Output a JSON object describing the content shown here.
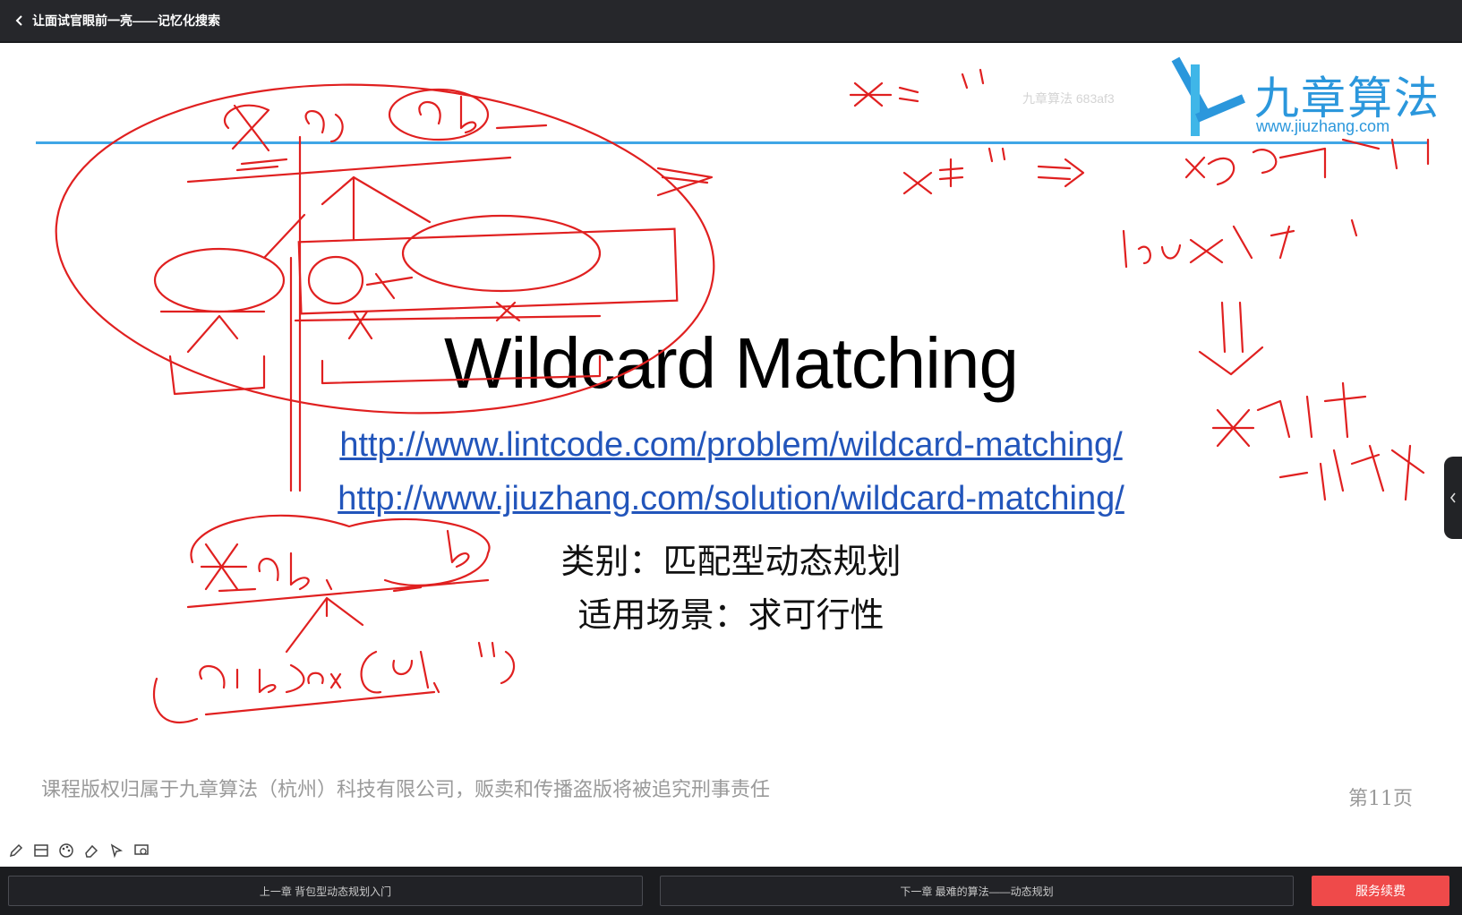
{
  "header": {
    "back_icon": "chevron-left-icon",
    "title": "让面试官眼前一亮——记忆化搜索"
  },
  "slide": {
    "logo_cn": "九章算法",
    "logo_url": "www.jiuzhang.com",
    "watermark": "九章算法 683af3",
    "title": "Wildcard Matching",
    "link1": "http://www.lintcode.com/problem/wildcard-matching/",
    "link2": "http://www.jiuzhang.com/solution/wildcard-matching/",
    "category": "类别：匹配型动态规划",
    "scenario": "适用场景：求可行性",
    "copyright": "课程版权归属于九章算法（杭州）科技有限公司，贩卖和传播盗版将被追究刑事责任",
    "page": "第11页"
  },
  "annotation": {
    "color": "#e02020"
  },
  "toolbar": {
    "tools": [
      "pencil-icon",
      "slides-icon",
      "palette-icon",
      "eraser-icon",
      "pointer-icon",
      "screen-icon"
    ]
  },
  "footer": {
    "prev_label": "上一章 背包型动态规划入门",
    "next_label": "下一章 最难的算法——动态规划",
    "renew_label": "服务续费"
  },
  "colors": {
    "accent_blue": "#3fa6e6",
    "link": "#2255bb",
    "renew": "#ef4a4a"
  }
}
